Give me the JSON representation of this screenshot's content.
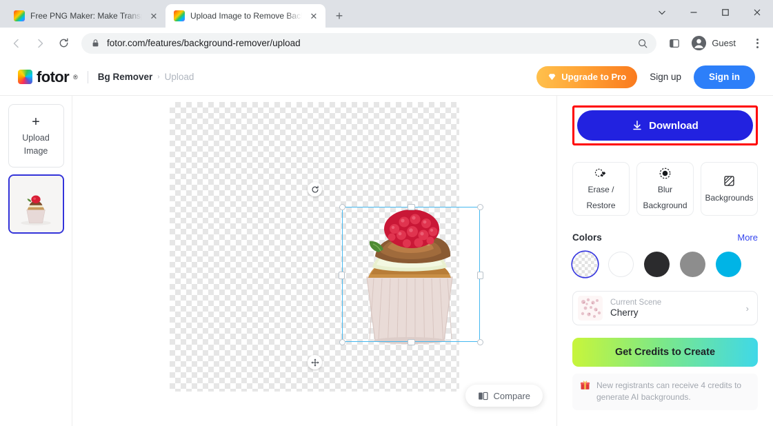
{
  "browser": {
    "tabs": [
      {
        "title": "Free PNG Maker: Make Transparent",
        "active": false,
        "close_icon": "close-icon"
      },
      {
        "title": "Upload Image to Remove Backgr",
        "active": true,
        "close_icon": "close-icon"
      }
    ],
    "new_tab_label": "+",
    "window_controls": {
      "collapse": "chevron-down-icon",
      "minimize": "minimize-icon",
      "maximize": "maximize-icon",
      "close": "close-icon"
    },
    "nav": {
      "back": "back-arrow-icon",
      "forward": "forward-arrow-icon",
      "reload": "reload-icon"
    },
    "omnibox": {
      "lock_icon": "lock-icon",
      "url": "fotor.com/features/background-remover/upload",
      "search_icon": "search-icon",
      "sidepanel_icon": "side-panel-icon"
    },
    "profile": {
      "avatar_icon": "account-circle-icon",
      "name": "Guest"
    },
    "menu_icon": "kebab-menu-icon"
  },
  "header": {
    "brand": {
      "logo_icon": "fotor-logo-icon",
      "name": "fotor",
      "trademark": "®"
    },
    "breadcrumb": {
      "section": "Bg Remover",
      "arrow": "›",
      "current": "Upload"
    },
    "upgrade": {
      "icon": "diamond-icon",
      "label": "Upgrade to Pro"
    },
    "sign_up": "Sign up",
    "sign_in": "Sign in"
  },
  "rail": {
    "upload": {
      "plus": "+",
      "line1": "Upload",
      "line2": "Image"
    },
    "thumbnail_name": "cupcake-thumbnail"
  },
  "canvas": {
    "rotate_icon": "rotate-icon",
    "move_icon": "move-icon",
    "image_name": "cupcake-image",
    "compare": {
      "icon": "compare-icon",
      "label": "Compare"
    }
  },
  "panel": {
    "download": {
      "icon": "download-icon",
      "label": "Download"
    },
    "tools": [
      {
        "icon": "eraser-icon",
        "line1": "Erase /",
        "line2": "Restore"
      },
      {
        "icon": "blur-icon",
        "line1": "Blur",
        "line2": "Background"
      },
      {
        "icon": "backgrounds-icon",
        "line1": "Backgrounds",
        "line2": ""
      }
    ],
    "colors": {
      "title": "Colors",
      "more": "More",
      "swatches": [
        {
          "name": "transparent",
          "hex": "transparent",
          "selected": true
        },
        {
          "name": "white",
          "hex": "#ffffff",
          "selected": false
        },
        {
          "name": "dark",
          "hex": "#2b2b2d",
          "selected": false
        },
        {
          "name": "gray",
          "hex": "#8d8d8d",
          "selected": false
        },
        {
          "name": "cyan",
          "hex": "#00b4e6",
          "selected": false
        }
      ]
    },
    "scene": {
      "label": "Current Scene",
      "value": "Cherry",
      "chevron": "›"
    },
    "credits_button": "Get Credits to Create",
    "credits_note": {
      "icon": "gift-icon",
      "text": "New registrants can receive 4 credits to generate AI backgrounds."
    }
  },
  "accents": {
    "download_blue": "#2222e0",
    "highlight_red": "#ff0000",
    "signin_blue": "#2d7ff9",
    "selection_blue": "#44b8f0"
  }
}
